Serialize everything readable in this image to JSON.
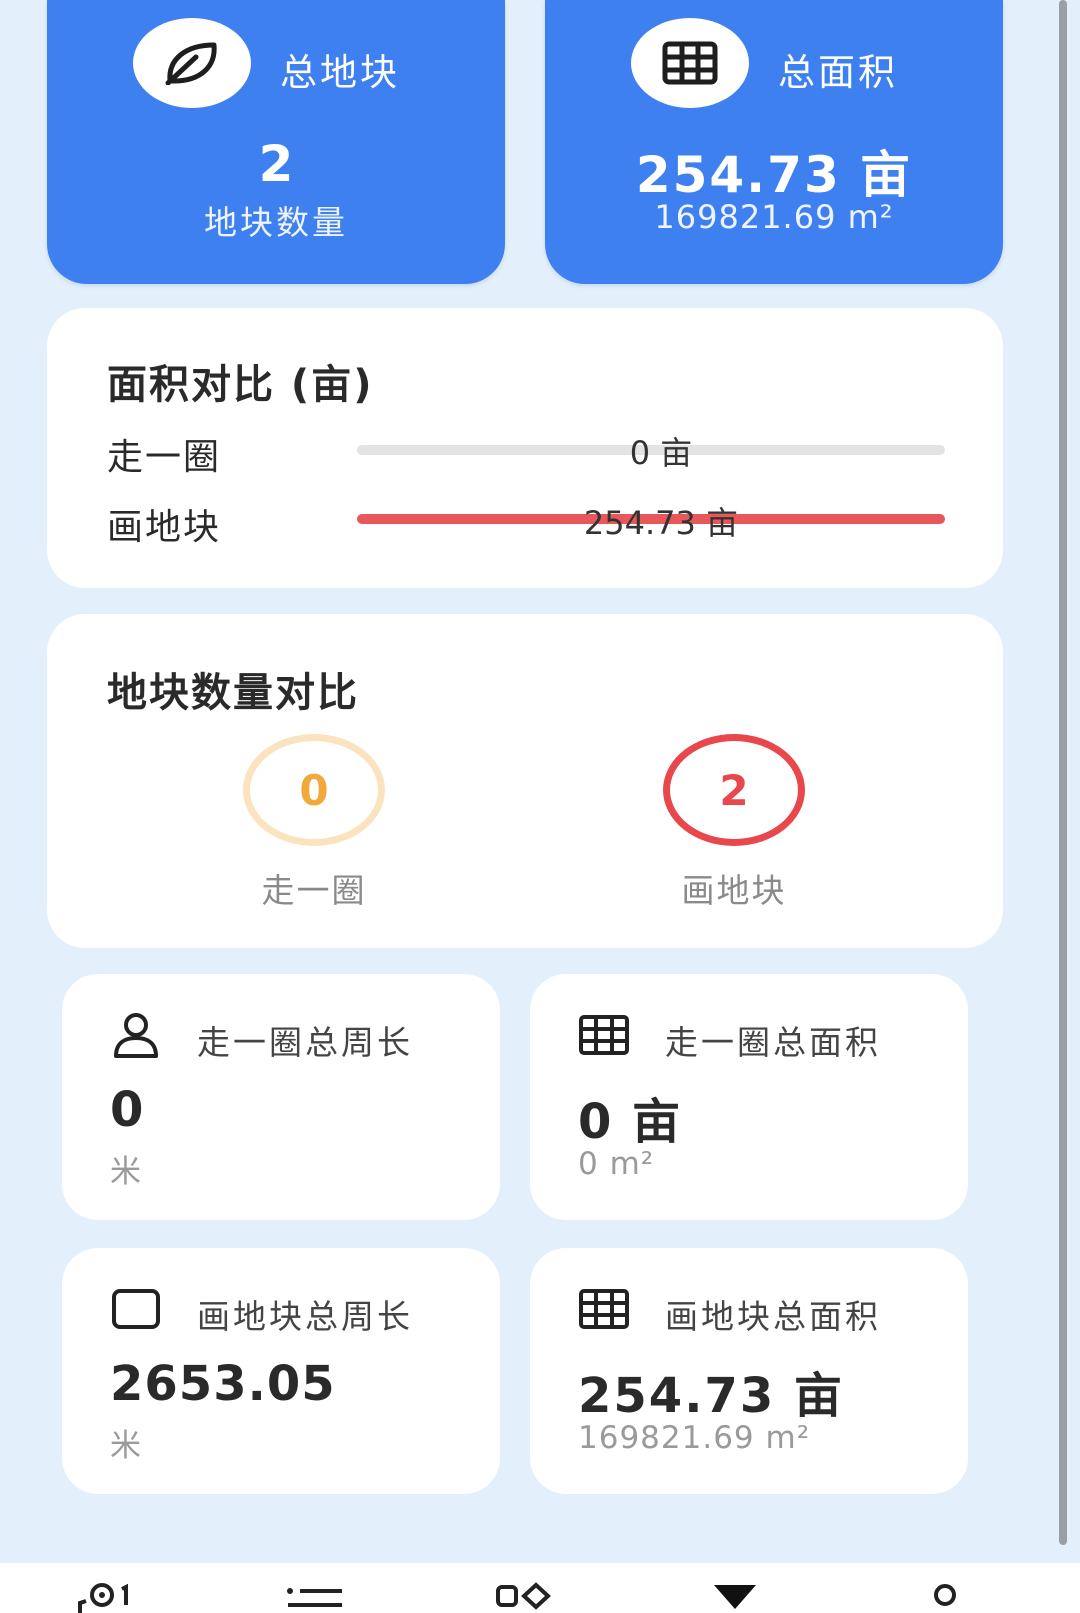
{
  "summary": {
    "plots": {
      "title": "总地块",
      "value": "2",
      "subtitle": "地块数量",
      "icon": "leaf-icon"
    },
    "area": {
      "title": "总面积",
      "value": "254.73 亩",
      "subtitle": "169821.69 m²",
      "icon": "grid-icon"
    }
  },
  "area_compare": {
    "title": "面积对比 (亩)",
    "rows": [
      {
        "label": "走一圈",
        "value_text": "0 亩",
        "fraction": 0,
        "color": "#e0e0e0"
      },
      {
        "label": "画地块",
        "value_text": "254.73 亩",
        "fraction": 1,
        "color": "#e8585a"
      }
    ]
  },
  "count_compare": {
    "title": "地块数量对比",
    "items": [
      {
        "value": "0",
        "label": "走一圈",
        "color": "#f2a93b",
        "ring": "#fbe3bf"
      },
      {
        "value": "2",
        "label": "画地块",
        "color": "#e8474c",
        "ring": "#e8474c"
      }
    ]
  },
  "stats": {
    "walk_perimeter": {
      "title": "走一圈总周长",
      "value": "0",
      "unit": "米",
      "icon": "person-icon"
    },
    "walk_area": {
      "title": "走一圈总面积",
      "value": "0 亩",
      "unit": "0 m²",
      "icon": "grid-icon"
    },
    "draw_perimeter": {
      "title": "画地块总周长",
      "value": "2653.05",
      "unit": "米",
      "icon": "square-icon"
    },
    "draw_area": {
      "title": "画地块总面积",
      "value": "254.73 亩",
      "unit": "169821.69 m²",
      "icon": "grid-icon"
    }
  },
  "nav": [
    "map-pin-icon",
    "list-icon",
    "apps-icon",
    "triangle-icon",
    "profile-icon"
  ]
}
